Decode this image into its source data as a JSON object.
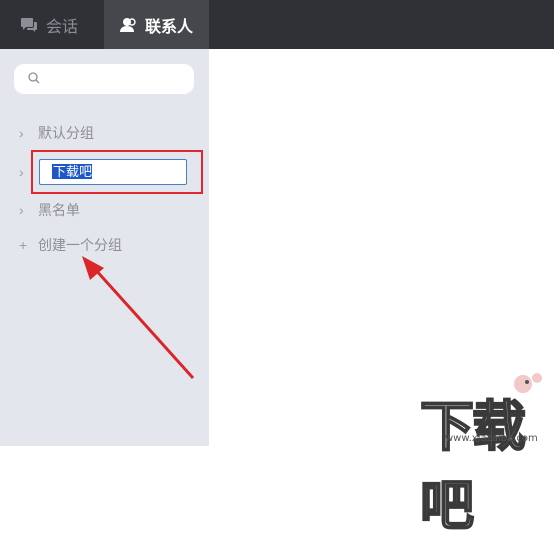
{
  "tabs": [
    {
      "label": "会话",
      "icon": "chat-bubble-icon"
    },
    {
      "label": "联系人",
      "icon": "contacts-icon"
    }
  ],
  "search": {
    "placeholder": "",
    "value": ""
  },
  "groups": [
    {
      "label": "默认分组",
      "icon": "chevron-right-icon"
    },
    {
      "label": "黑名单",
      "icon": "chevron-right-icon"
    }
  ],
  "editing_group": {
    "value": "下载吧"
  },
  "create_group": {
    "label": "创建一个分组",
    "icon": "plus-icon"
  },
  "watermark": {
    "text": "下载吧",
    "url": "www.xiazaiba.com"
  },
  "colors": {
    "topbar": "#2f3136",
    "active_tab": "#45474d",
    "sidebar": "#e3e6ec",
    "highlight": "#e0262e",
    "selection": "#1e58c8"
  }
}
